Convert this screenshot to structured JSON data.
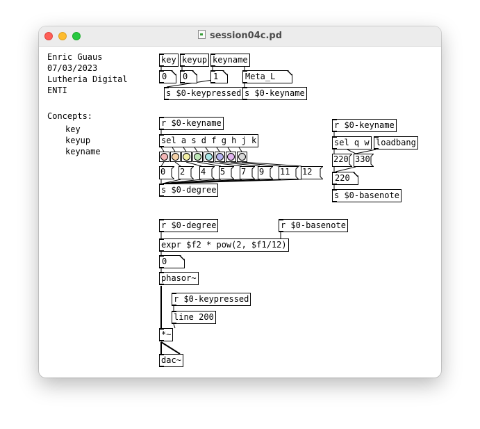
{
  "window": {
    "title": "session04c.pd"
  },
  "comments": {
    "author": "Enric Guaus",
    "date": "07/03/2023",
    "course": "Lutheria Digital",
    "school": "ENTI",
    "concepts_heading": "Concepts:",
    "concepts": [
      "key",
      "keyup",
      "keyname"
    ]
  },
  "objects": {
    "key": "key",
    "keyup": "keyup",
    "keyname": "keyname",
    "s_keypressed": "s $0-keypressed",
    "s_keyname": "s $0-keyname",
    "r_keyname_1": "r $0-keyname",
    "sel_keys": "sel a s d f g h j k",
    "s_degree": "s $0-degree",
    "r_keyname_2": "r $0-keyname",
    "sel_qw": "sel q w",
    "loadbang": "loadbang",
    "s_basenote": "s $0-basenote",
    "r_degree": "r $0-degree",
    "r_basenote": "r $0-basenote",
    "expr": "expr $f2 * pow(2, $f1/12)",
    "phasor": "phasor~",
    "r_keypressed": "r $0-keypressed",
    "line": "line 200",
    "mult": "*~",
    "dac": "dac~"
  },
  "atoms": {
    "key_out": "0",
    "keyup_out": "0",
    "keyname_out": "1",
    "keyname_sym": "Meta_L",
    "basenote_val": "220",
    "freq_out": "0"
  },
  "messages": {
    "degrees": [
      "0",
      "2",
      "4",
      "5",
      "7",
      "9",
      "11",
      "12"
    ],
    "base_220": "220",
    "base_330": "330"
  },
  "bang_colors": [
    "#f4b6b6",
    "#f6d2a8",
    "#f4f0a6",
    "#bfe8b8",
    "#a8e6e6",
    "#b9b6f2",
    "#e2b6f0",
    "#d8d8d8"
  ]
}
